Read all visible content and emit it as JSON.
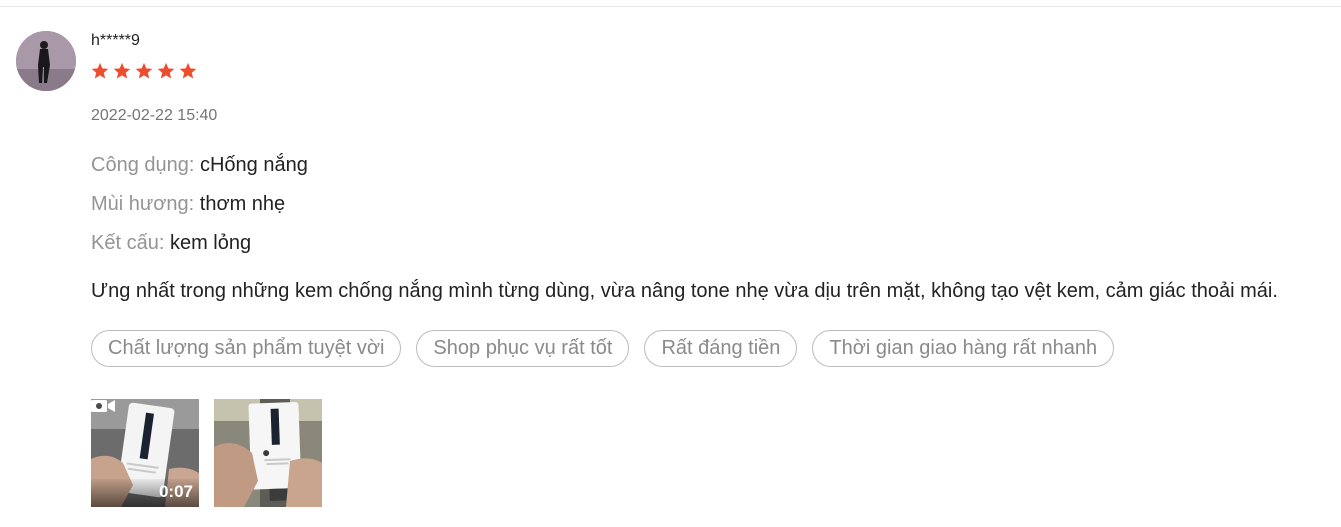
{
  "review": {
    "username": "h*****9",
    "rating": 5,
    "star_color": "#ee4d2d",
    "timestamp": "2022-02-22 15:40",
    "attributes": [
      {
        "label": "Công dụng:",
        "value": "cHống nắng"
      },
      {
        "label": "Mùi hương:",
        "value": "thơm nhẹ"
      },
      {
        "label": "Kết cấu:",
        "value": "kem lỏng"
      }
    ],
    "text": "Ưng nhất trong những kem chống nắng mình từng dùng, vừa nâng tone nhẹ vừa dịu trên mặt, không tạo vệt kem, cảm giác thoải mái.",
    "tags": [
      "Chất lượng sản phẩm tuyệt vời",
      "Shop phục vụ rất tốt",
      "Rất đáng tiền",
      "Thời gian giao hàng rất nhanh"
    ],
    "media": [
      {
        "type": "video",
        "duration": "0:07",
        "icon": "video-camera-icon"
      },
      {
        "type": "image"
      }
    ]
  }
}
